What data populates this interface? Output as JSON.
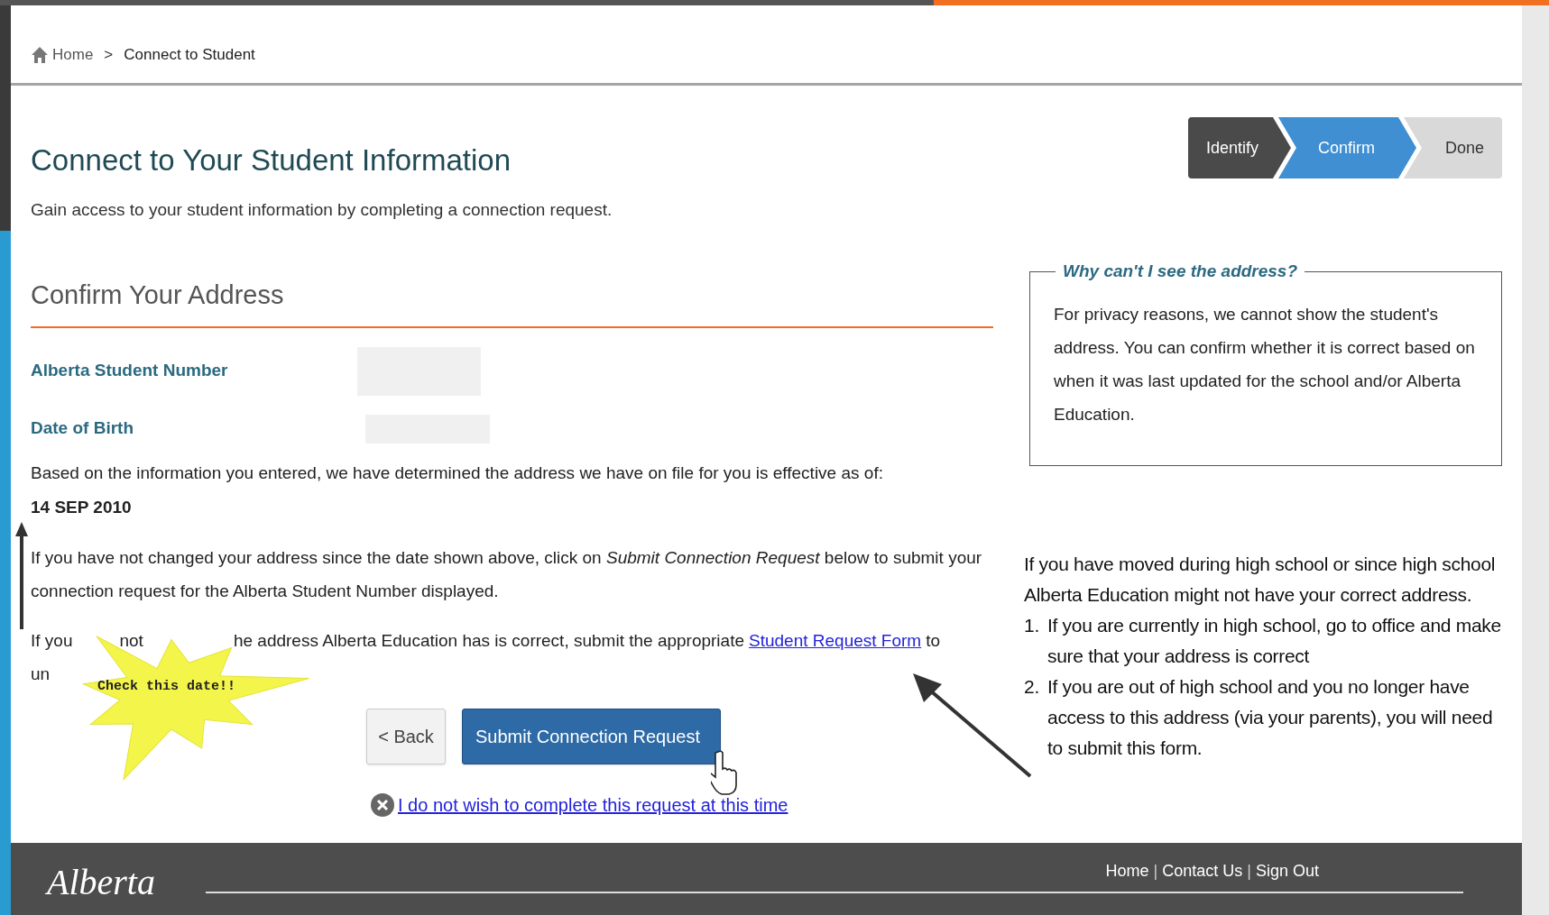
{
  "breadcrumb": [
    {
      "kind": "home",
      "label": "Home"
    },
    {
      "kind": "separator",
      "label": ">"
    },
    {
      "kind": "current",
      "label": "Connect to Student"
    }
  ],
  "page": {
    "title": "Connect to Your Student Information",
    "subtitle": "Gain access to your student information by completing a connection request."
  },
  "steps": [
    {
      "label": "Identify",
      "selected": false,
      "completed": true
    },
    {
      "label": "Confirm",
      "selected": true,
      "completed": false
    },
    {
      "label": "Done",
      "selected": false,
      "completed": false
    }
  ],
  "section": {
    "heading": "Confirm Your Address"
  },
  "fields": [
    {
      "label": "Alberta Student Number"
    },
    {
      "label": "Date of Birth"
    }
  ],
  "effective_text": "Based on the information you entered, we have determined the address we have on file for you is effective as of:",
  "effective_date": "14 SEP 2010",
  "instruction": "If you have not changed your address since the date shown above, click on *Submit Connection Request* below to submit your connection request for the Alberta Student Number displayed.",
  "update_note": {
    "fragments": [
      "If you",
      "not",
      "he address Alberta Education has is correct, submit the appropriate"
    ],
    "link": "Student Request Form",
    "after": "to",
    "second_line": "un"
  },
  "buttons": [
    {
      "label": "< Back",
      "kind": "secondary"
    },
    {
      "label": "Submit Connection Request",
      "kind": "primary"
    }
  ],
  "cancel_link": "I do not wish to complete this request at this time",
  "info_box": {
    "legend": "Why can't I see the address?",
    "text": "For privacy reasons, we cannot show the student's address. You can confirm whether it is correct based on when it was last updated for the school and/or Alberta Education."
  },
  "callout": "Check this date!!",
  "note": {
    "intro": "If you have moved during high school or since high school Alberta Education might not have your correct address.",
    "items": [
      {
        "number": "1.",
        "text": "If you are currently in high school, go to office and make sure that your address is correct"
      },
      {
        "number": "2.",
        "text": "If you are out of high school and you no longer have access to this address (via your parents), you will need to submit this form."
      }
    ]
  },
  "footer": {
    "logo": "Alberta",
    "links": [
      {
        "kind": "link",
        "label": "Home"
      },
      {
        "kind": "separator",
        "label": "|"
      },
      {
        "kind": "link",
        "label": "Contact Us"
      },
      {
        "kind": "separator",
        "label": "|"
      },
      {
        "kind": "link",
        "label": "Sign Out"
      }
    ]
  }
}
